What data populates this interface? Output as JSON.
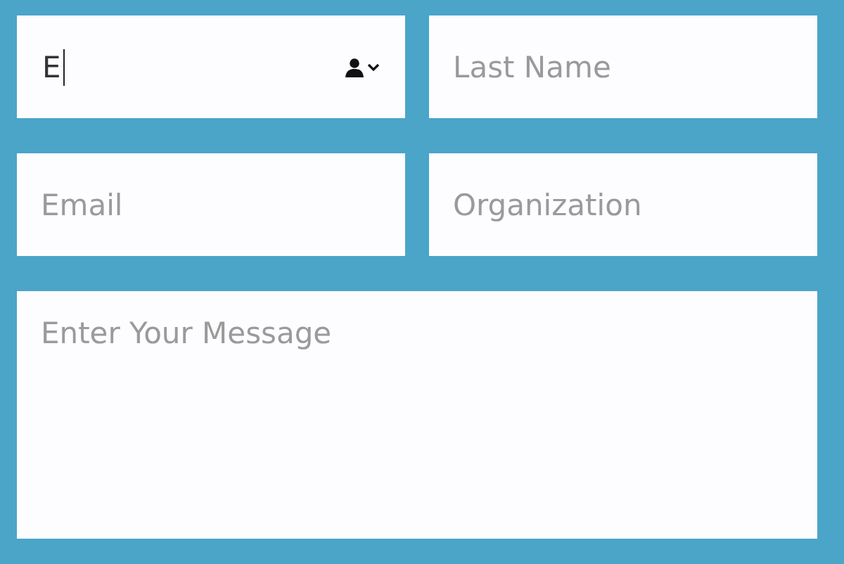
{
  "fields": [
    {
      "kind": "contact",
      "value": "E",
      "focused": true
    },
    {
      "kind": "text",
      "placeholder": "Last Name",
      "focused": false
    },
    {
      "kind": "text",
      "placeholder": "Email",
      "focused": false
    },
    {
      "kind": "text",
      "placeholder": "Organization",
      "focused": false
    },
    {
      "kind": "textarea",
      "placeholder": "Enter Your Message",
      "focused": false
    }
  ]
}
